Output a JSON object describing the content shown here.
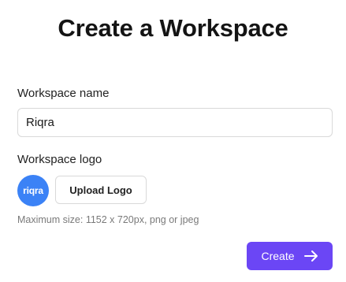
{
  "header": {
    "title": "Create a Workspace"
  },
  "workspace_name": {
    "label": "Workspace name",
    "value": "Riqra"
  },
  "workspace_logo": {
    "label": "Workspace logo",
    "logo_text": "riqra",
    "upload_label": "Upload Logo",
    "hint": "Maximum size: 1152 x 720px, png or jpeg"
  },
  "actions": {
    "create_label": "Create",
    "create_icon": "arrow-right-icon"
  },
  "colors": {
    "accent": "#6b46f5",
    "logo_bg": "#3b82f6",
    "border": "#d9d9d9",
    "hint_text": "#7a7a7a"
  }
}
